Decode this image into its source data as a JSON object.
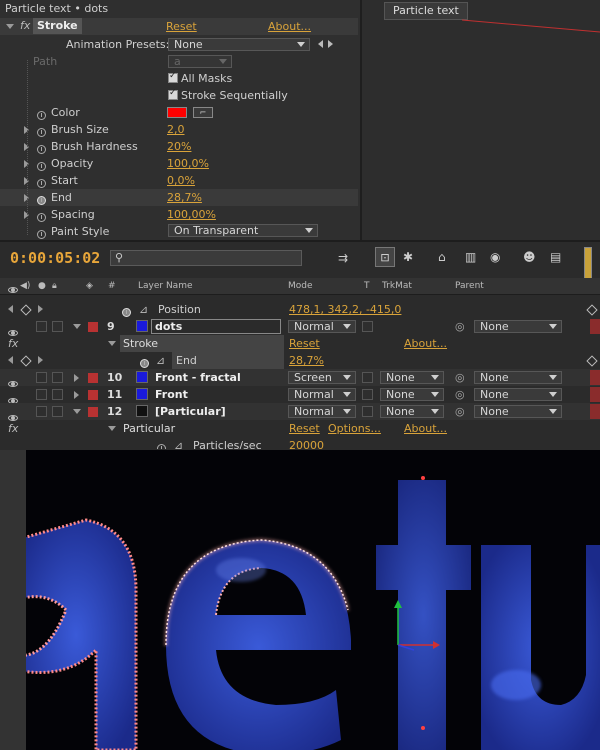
{
  "effect_controls": {
    "title": "Particle text • dots",
    "effect_name": "Stroke",
    "reset": "Reset",
    "about": "About...",
    "animation_presets_label": "Animation Presets:",
    "animation_presets_value": "None",
    "path_label": "Path",
    "path_value": "a",
    "all_masks": "All Masks",
    "stroke_sequentially": "Stroke Sequentially",
    "properties": [
      {
        "label": "Color",
        "value": ""
      },
      {
        "label": "Brush Size",
        "value": "2,0"
      },
      {
        "label": "Brush Hardness",
        "value": "20%"
      },
      {
        "label": "Opacity",
        "value": "100,0%"
      },
      {
        "label": "Start",
        "value": "0,0%"
      },
      {
        "label": "End",
        "value": "28,7%"
      },
      {
        "label": "Spacing",
        "value": "100,00%"
      },
      {
        "label": "Paint Style",
        "value": "On Transparent"
      }
    ],
    "color_swatch": "#ff0000"
  },
  "composition": {
    "tab": "Particle text"
  },
  "timeline": {
    "timecode": "0:00:05:02",
    "headers": {
      "layer_name": "Layer Name",
      "mode": "Mode",
      "t": "T",
      "trkmat": "TrkMat",
      "parent": "Parent"
    },
    "position_label": "Position",
    "position_value": "478,1, 342,2, -415,0",
    "layers": [
      {
        "num": "9",
        "name": "dots",
        "mode": "Normal",
        "trkmat": "",
        "parent": "None",
        "color": "#1a1adb",
        "label": "#b83232"
      },
      {
        "num": "10",
        "name": "Front - fractal",
        "mode": "Screen",
        "trkmat": "None",
        "parent": "None",
        "color": "#1a1adb",
        "label": "#b83232"
      },
      {
        "num": "11",
        "name": "Front",
        "mode": "Normal",
        "trkmat": "None",
        "parent": "None",
        "color": "#1a1adb",
        "label": "#b83232"
      },
      {
        "num": "12",
        "name": "[Particular]",
        "mode": "Normal",
        "trkmat": "None",
        "parent": "None",
        "color": "#111111",
        "label": "#b83232"
      }
    ],
    "stroke_effect": "Stroke",
    "stroke_reset": "Reset",
    "stroke_about": "About...",
    "end_label": "End",
    "end_value": "28,7%",
    "particular_effect": "Particular",
    "particular_reset": "Reset",
    "particular_options": "Options...",
    "particular_about": "About...",
    "particles_label": "Particles/sec",
    "particles_value": "20000",
    "fx": "fx"
  },
  "viewer": {
    "letters": [
      "a",
      "e",
      "t",
      "u"
    ]
  }
}
